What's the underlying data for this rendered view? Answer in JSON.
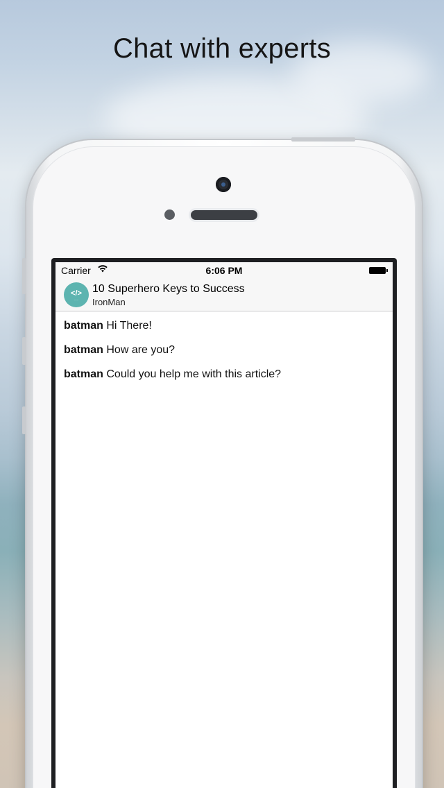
{
  "headline": "Chat with experts",
  "status_bar": {
    "carrier": "Carrier",
    "wifi_icon": "wifi-icon",
    "time": "6:06 PM",
    "battery_icon": "battery-icon"
  },
  "chat_header": {
    "avatar_icon": "code-logo-icon",
    "avatar_glyph": "</>",
    "title": "10 Superhero Keys to Success",
    "subtitle": "IronMan"
  },
  "messages": [
    {
      "user": "batman",
      "text": "Hi There!"
    },
    {
      "user": "batman",
      "text": "How are you?"
    },
    {
      "user": "batman",
      "text": "Could you help me with this article?"
    }
  ],
  "colors": {
    "avatar_bg": "#5db4b0",
    "navbar_bg": "#f7f7f7",
    "headline": "#151515"
  }
}
